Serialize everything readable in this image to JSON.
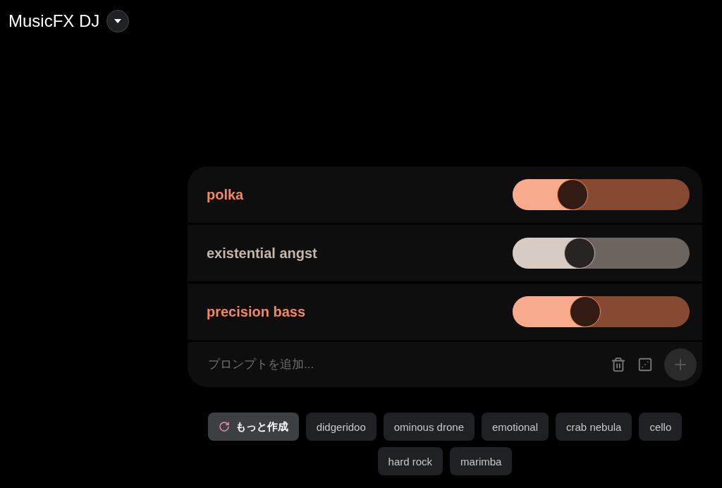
{
  "app_title": "MusicFX DJ",
  "prompts": [
    {
      "label": "polka",
      "level": 0.34,
      "color": "#f4875b"
    },
    {
      "label": "existential angst",
      "level": 0.38,
      "color": "#c4b6aa"
    },
    {
      "label": "precision bass",
      "level": 0.41,
      "color": "#f4875b"
    }
  ],
  "prompt_input": {
    "placeholder": "プロンプトを追加..."
  },
  "chips": [
    {
      "label": "もっと作成",
      "kind": "action"
    },
    {
      "label": "didgeridoo",
      "kind": "suggestion"
    },
    {
      "label": "ominous drone",
      "kind": "suggestion"
    },
    {
      "label": "emotional",
      "kind": "suggestion"
    },
    {
      "label": "crab nebula",
      "kind": "suggestion"
    },
    {
      "label": "cello",
      "kind": "suggestion"
    },
    {
      "label": "hard rock",
      "kind": "suggestion"
    },
    {
      "label": "marimba",
      "kind": "suggestion"
    }
  ]
}
